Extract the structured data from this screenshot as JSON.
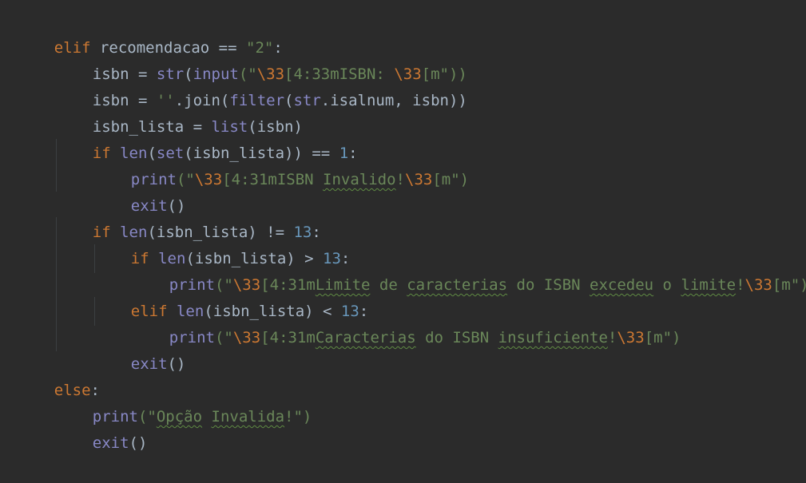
{
  "lines": [
    [
      "elif",
      " recomendacao == ",
      "\"2\"",
      ":"
    ],
    [
      "isbn = ",
      "str",
      "(",
      "input",
      "(\"",
      "\\33",
      "[4:33mISBN: ",
      "\\33",
      "[m\"))"
    ],
    [
      "isbn = ",
      "''",
      ".join(",
      "filter",
      "(",
      "str",
      ".isalnum, isbn))"
    ],
    [
      "isbn_lista = ",
      "list",
      "(isbn)"
    ],
    [
      "if",
      " ",
      "len",
      "(",
      "set",
      "(isbn_lista)) == ",
      "1",
      ":"
    ],
    [
      "print",
      "(\"",
      "\\33",
      "[4:31mISBN ",
      "Invalido",
      "!",
      "\\33",
      "[m\")"
    ],
    [
      "exit",
      "()"
    ],
    [
      "if",
      " ",
      "len",
      "(isbn_lista) != ",
      "13",
      ":"
    ],
    [
      "if",
      " ",
      "len",
      "(isbn_lista) > ",
      "13",
      ":"
    ],
    [
      "print",
      "(\"",
      "\\33",
      "[4:31m",
      "Limite",
      " de ",
      "caracterias",
      " do ISBN ",
      "excedeu",
      " o ",
      "limite",
      "!",
      "\\33",
      "[m\")"
    ],
    [
      "elif",
      " ",
      "len",
      "(isbn_lista) < ",
      "13",
      ":"
    ],
    [
      "print",
      "(\"",
      "\\33",
      "[4:31m",
      "Caracterias",
      " do ISBN ",
      "insuficiente",
      "!",
      "\\33",
      "[m\")"
    ],
    [
      "exit",
      "()"
    ],
    [
      "else",
      ":"
    ],
    [
      "print",
      "(\"",
      "Opção",
      " ",
      "Invalida",
      "!\")"
    ],
    [
      "exit",
      "()"
    ]
  ]
}
